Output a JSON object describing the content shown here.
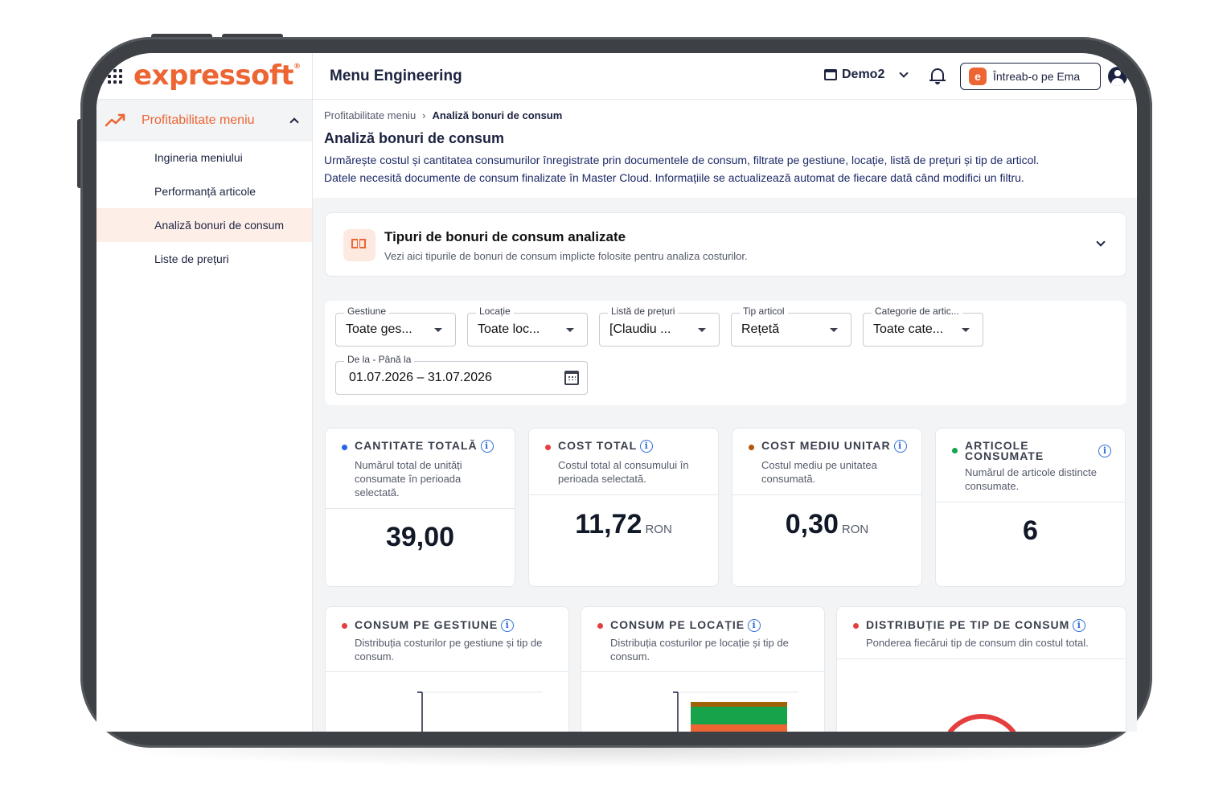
{
  "app": {
    "logo_text": "expressoft",
    "title": "Menu Engineering",
    "store": "Demo2",
    "ask_ema_label": "Întreab-o pe Ema"
  },
  "sidebar": {
    "group_label": "Profitabilitate meniu",
    "items": [
      {
        "label": "Ingineria meniului",
        "active": false
      },
      {
        "label": "Performanță articole",
        "active": false
      },
      {
        "label": "Analiză bonuri de consum",
        "active": true
      },
      {
        "label": "Liste de prețuri",
        "active": false
      }
    ]
  },
  "breadcrumb": {
    "parent": "Profitabilitate meniu",
    "separator": "›",
    "current": "Analiză bonuri de consum"
  },
  "page": {
    "title": "Analiză bonuri de consum",
    "desc_line1": "Urmărește costul și cantitatea consumurilor înregistrate prin documentele de consum, filtrate pe gestiune, locație, listă de prețuri și tip de articol.",
    "desc_line2": "Datele necesită documente de consum finalizate în Master Cloud. Informațiile se actualizează automat de fiecare dată când modifici un filtru."
  },
  "info_panel": {
    "title": "Tipuri de bonuri de consum analizate",
    "subtitle": "Vezi aici tipurile de bonuri de consum implicte folosite pentru analiza costurilor."
  },
  "filters": [
    {
      "label": "Gestiune",
      "value": "Toate ges..."
    },
    {
      "label": "Locație",
      "value": "Toate loc..."
    },
    {
      "label": "Listă de prețuri",
      "value": "[Claudiu ..."
    },
    {
      "label": "Tip articol",
      "value": "Rețetă"
    },
    {
      "label": "Categorie de artic...",
      "value": "Toate cate..."
    }
  ],
  "date_range": {
    "label": "De la - Până la",
    "value": "01.07.2026 – 31.07.2026"
  },
  "kpis": [
    {
      "title": "CANTITATE TOTALĂ",
      "desc": "Numărul total de unități consumate în perioada selectată.",
      "value": "39,00",
      "unit": "",
      "dot_color": "#2563eb"
    },
    {
      "title": "COST TOTAL",
      "desc": "Costul total al consumului în perioada selectată.",
      "value": "11,72",
      "unit": "RON",
      "dot_color": "#e53e3e"
    },
    {
      "title": "COST MEDIU UNITAR",
      "desc": "Costul mediu pe unitatea consumată.",
      "value": "0,30",
      "unit": "RON",
      "dot_color": "#b45309"
    },
    {
      "title": "ARTICOLE CONSUMATE",
      "desc": "Numărul de articole distincte consumate.",
      "value": "6",
      "unit": "",
      "dot_color": "#16a34a"
    }
  ],
  "charts": [
    {
      "title": "CONSUM PE GESTIUNE",
      "desc": "Distribuția costurilor pe gestiune și tip de consum."
    },
    {
      "title": "CONSUM PE LOCAȚIE",
      "desc": "Distribuția costurilor pe locație și tip de consum."
    },
    {
      "title": "DISTRIBUȚIE PE TIP DE CONSUM",
      "desc": "Ponderea fiecărui tip de consum din costul total."
    }
  ],
  "colors": {
    "brand": "#ec6533",
    "navy": "#1c2340",
    "info_blue": "#2f6fd6",
    "bar_green": "#16a34a",
    "bar_orange": "#ec6533",
    "bar_brown": "#a16207"
  }
}
